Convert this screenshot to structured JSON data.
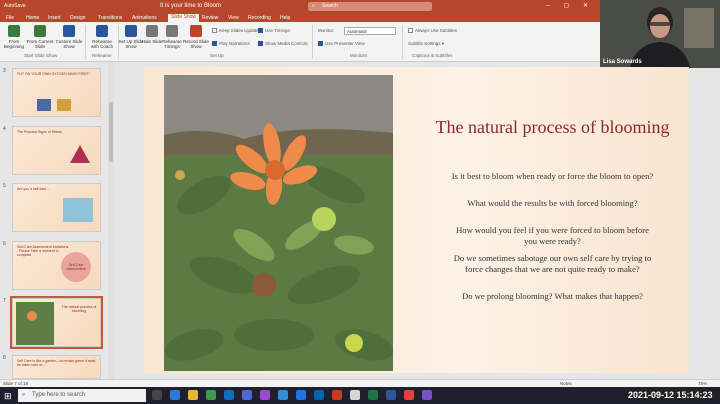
{
  "titlebar": {
    "autosave": "AutoSave",
    "doc_title": "It is your time to Bloom",
    "search_placeholder": "Search",
    "search_icon": "search-icon",
    "window_controls": "─ ▢ ✕"
  },
  "menu": [
    "File",
    "Home",
    "Insert",
    "Design",
    "Transitions",
    "Animations",
    "Slide Show",
    "Review",
    "View",
    "Recording",
    "Help"
  ],
  "ribbon": {
    "buttons": [
      {
        "label": "From Beginning",
        "icon": "play-icon",
        "color": "#3c7a3c"
      },
      {
        "label": "From Current Slide",
        "icon": "play-current-icon",
        "color": "#3c7a3c"
      },
      {
        "label": "Custom Slide Show",
        "icon": "custom-show-icon",
        "color": "#2b579a"
      },
      {
        "label": "Rehearse with Coach",
        "icon": "coach-icon",
        "color": "#2b579a"
      },
      {
        "label": "Set Up Slide Show",
        "icon": "setup-icon",
        "color": "#2b579a"
      },
      {
        "label": "Hide Slide",
        "icon": "hide-slide-icon",
        "color": "#777"
      },
      {
        "label": "Rehearse Timings",
        "icon": "timer-icon",
        "color": "#777"
      },
      {
        "label": "Record Slide Show",
        "icon": "record-icon",
        "color": "#b7472a"
      }
    ],
    "groups": [
      "Start Slide Show",
      "Rehearse",
      "Set Up",
      "Monitors",
      "Captions & Subtitles"
    ],
    "checks": [
      {
        "label": "Keep Slides Updated",
        "on": false
      },
      {
        "label": "Play Narrations",
        "on": true
      },
      {
        "label": "Use Timings",
        "on": true
      },
      {
        "label": "Show Media Controls",
        "on": true
      },
      {
        "label": "Use Presenter View",
        "on": true
      },
      {
        "label": "Always Use Subtitles",
        "on": false
      }
    ],
    "monitor_label": "Monitor:",
    "monitor_value": "Automatic",
    "subtitle_settings": "Subtitle Settings"
  },
  "thumbnails": [
    {
      "num": "3",
      "title": "PUT ON YOUR OWN OXYGEN MASK FIRST!"
    },
    {
      "num": "4",
      "title": "The Physical Signs of Stress"
    },
    {
      "num": "5",
      "title": "Are you a self-care…"
    },
    {
      "num": "6",
      "title": "Self-Care Assessment Invitations - Please Take a moment to complete",
      "badge": "Self-Care Assessment"
    },
    {
      "num": "7",
      "title": "The natural process of blooming"
    },
    {
      "num": "8",
      "title": "Self Care is like a garden—to remain green it must be taken care of…"
    }
  ],
  "slide": {
    "title": "The natural process of blooming",
    "questions": [
      "Is it best to bloom when ready or force the bloom to open?",
      "What would the results be with forced blooming?",
      "How would you feel if you were forced to bloom before you were ready?",
      "Do we sometimes sabotage our own self care by trying to force changes that we are not quite ready to make?",
      "Do we prolong blooming?  What makes that happen?"
    ]
  },
  "status": {
    "slide_of": "Slide 7 of 18",
    "notes": "Notes",
    "zoom": "75%"
  },
  "taskbar": {
    "search": "Type here to search",
    "datetime": "2021-09-12  15:14:23"
  },
  "webcam": {
    "name": "Lisa Sowards"
  }
}
